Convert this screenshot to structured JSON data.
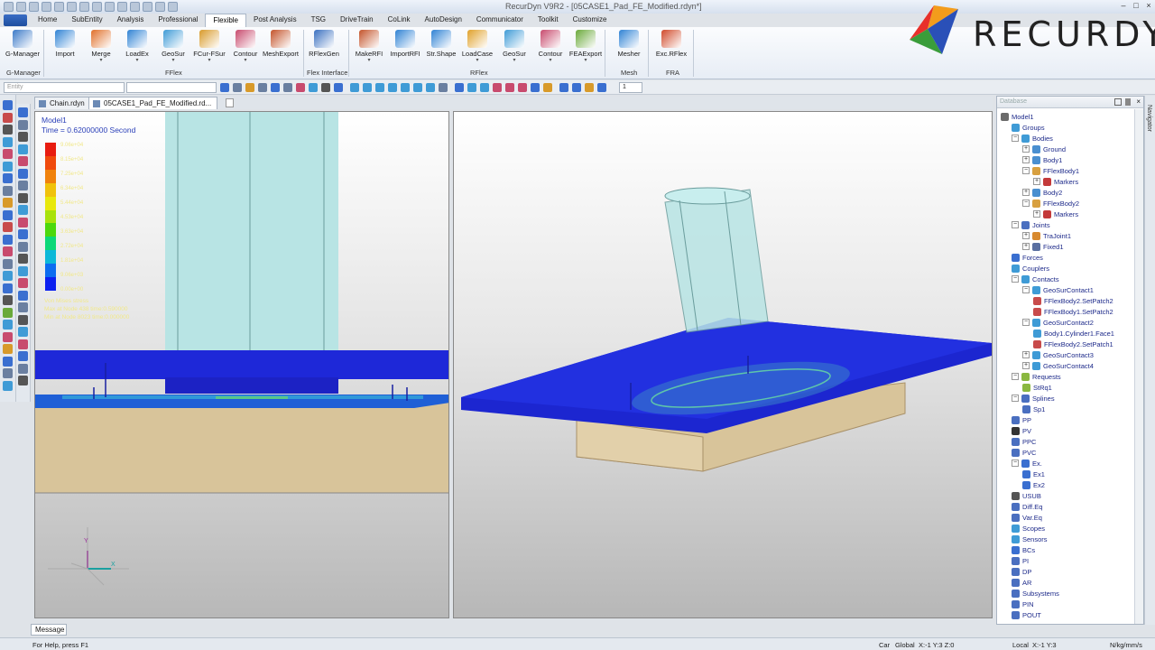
{
  "window": {
    "title": "RecurDyn V9R2 - [05CASE1_Pad_FE_Modified.rdyn*]",
    "controls": [
      "–",
      "□",
      "×"
    ]
  },
  "menu": {
    "tabs": [
      "Home",
      "SubEntity",
      "Analysis",
      "Professional",
      "Flexible",
      "Post Analysis",
      "TSG",
      "DriveTrain",
      "CoLink",
      "AutoDesign",
      "Communicator",
      "Toolkit",
      "Customize"
    ],
    "active": "Flexible"
  },
  "ribbon": {
    "buttons": [
      {
        "label": "G-Manager",
        "arrow": "",
        "color": "#3c7ac8"
      },
      {
        "label": "Import",
        "arrow": "",
        "color": "#2f82d4"
      },
      {
        "label": "Merge",
        "arrow": "▾",
        "color": "#e0702a"
      },
      {
        "label": "LoadEx",
        "arrow": "▾",
        "color": "#2f82d4"
      },
      {
        "label": "GeoSur",
        "arrow": "▾",
        "color": "#3f9bd6"
      },
      {
        "label": "FCur-FSur",
        "arrow": "▾",
        "color": "#d89a2a"
      },
      {
        "label": "Contour",
        "arrow": "▾",
        "color": "#c84b6e"
      },
      {
        "label": "MeshExport",
        "arrow": "",
        "color": "#c4542b"
      },
      {
        "label": "RFlexGen",
        "arrow": "",
        "color": "#3a70c0"
      },
      {
        "label": "MakeRFI",
        "arrow": "▾",
        "color": "#c4542b"
      },
      {
        "label": "ImportRFI",
        "arrow": "",
        "color": "#2f82d4"
      },
      {
        "label": "Str.Shape",
        "arrow": "",
        "color": "#2f82d4"
      },
      {
        "label": "LoadCase",
        "arrow": "▾",
        "color": "#e0a12a"
      },
      {
        "label": "GeoSur",
        "arrow": "▾",
        "color": "#3f9bd6"
      },
      {
        "label": "Contour",
        "arrow": "▾",
        "color": "#c84b6e"
      },
      {
        "label": "FEAExport",
        "arrow": "▾",
        "color": "#6aa93a"
      },
      {
        "label": "Mesher",
        "arrow": "",
        "color": "#2f82d4"
      },
      {
        "label": "Exc.RFlex",
        "arrow": "",
        "color": "#d04a2a"
      }
    ],
    "groups": [
      "G-Manager",
      "FFlex",
      "Flex Interface",
      "RFlex",
      "Mesh",
      "FRA"
    ]
  },
  "brand": {
    "logo_text": "RECURDYN"
  },
  "toolbar": {
    "entity_placeholder": "Entity",
    "step_value": "1"
  },
  "doc_tabs": [
    {
      "label": "Chain.rdyn"
    },
    {
      "label": "05CASE1_Pad_FE_Modified.rd..."
    }
  ],
  "viewport_left": {
    "model_name": "Model1",
    "time_text": "Time = 0.62000000  Second",
    "legend_values": [
      "9.06e+04",
      "8.15e+04",
      "7.25e+04",
      "6.34e+04",
      "5.44e+04",
      "4.53e+04",
      "3.63e+04",
      "2.72e+04",
      "1.81e+04",
      "9.06e+03",
      "0.00e+00"
    ],
    "legend_colors": [
      "#e81c10",
      "#f04a0c",
      "#f0820c",
      "#f0c20c",
      "#e8e80c",
      "#a8e20c",
      "#4cd80c",
      "#0cd878",
      "#0cb8d8",
      "#0c6cf0",
      "#0c20f0"
    ],
    "stress_title": "Von Mises stress",
    "stress_max": "Max at Node 438 time:0.590000",
    "stress_min": "Min at Node 8023 time:0.000000",
    "axis_x": "X",
    "axis_y": "Y",
    "axis_z": "Z"
  },
  "database": {
    "title": "Database",
    "tree": [
      {
        "label": "Model1",
        "level": 0,
        "toggle": "",
        "icon": "#6b6b6b"
      },
      {
        "label": "Groups",
        "level": 1,
        "toggle": "",
        "icon": "#3f9bd6"
      },
      {
        "label": "Bodies",
        "level": 1,
        "toggle": "−",
        "icon": "#3f9bd6"
      },
      {
        "label": "Ground",
        "level": 2,
        "toggle": "+",
        "icon": "#4a8fd0"
      },
      {
        "label": "Body1",
        "level": 2,
        "toggle": "+",
        "icon": "#4a8fd0"
      },
      {
        "label": "FFlexBody1",
        "level": 2,
        "toggle": "−",
        "icon": "#d8a040"
      },
      {
        "label": "Markers",
        "level": 3,
        "toggle": "+",
        "icon": "#c43a3a"
      },
      {
        "label": "Body2",
        "level": 2,
        "toggle": "+",
        "icon": "#4a8fd0"
      },
      {
        "label": "FFlexBody2",
        "level": 2,
        "toggle": "−",
        "icon": "#d8a040"
      },
      {
        "label": "Markers",
        "level": 3,
        "toggle": "+",
        "icon": "#c43a3a"
      },
      {
        "label": "Joints",
        "level": 1,
        "toggle": "−",
        "icon": "#4a6fc0"
      },
      {
        "label": "TraJoint1",
        "level": 2,
        "toggle": "+",
        "icon": "#d88a30"
      },
      {
        "label": "Fixed1",
        "level": 2,
        "toggle": "+",
        "icon": "#5a6fa0"
      },
      {
        "label": "Forces",
        "level": 1,
        "toggle": "",
        "icon": "#3a6fd0"
      },
      {
        "label": "Couplers",
        "level": 1,
        "toggle": "",
        "icon": "#3f9bd6"
      },
      {
        "label": "Contacts",
        "level": 1,
        "toggle": "−",
        "icon": "#3f9bd6"
      },
      {
        "label": "GeoSurContact1",
        "level": 2,
        "toggle": "−",
        "icon": "#3f9bd6"
      },
      {
        "label": "FFlexBody2.SetPatch2",
        "level": 3,
        "toggle": "",
        "icon": "#c84b4b"
      },
      {
        "label": "FFlexBody1.SetPatch2",
        "level": 3,
        "toggle": "",
        "icon": "#c84b4b"
      },
      {
        "label": "GeoSurContact2",
        "level": 2,
        "toggle": "−",
        "icon": "#3f9bd6"
      },
      {
        "label": "Body1.Cylinder1.Face1",
        "level": 3,
        "toggle": "",
        "icon": "#3f9bd6"
      },
      {
        "label": "FFlexBody2.SetPatch1",
        "level": 3,
        "toggle": "",
        "icon": "#c84b4b"
      },
      {
        "label": "GeoSurContact3",
        "level": 2,
        "toggle": "+",
        "icon": "#3f9bd6"
      },
      {
        "label": "GeoSurContact4",
        "level": 2,
        "toggle": "+",
        "icon": "#3f9bd6"
      },
      {
        "label": "Requests",
        "level": 1,
        "toggle": "−",
        "icon": "#8ab840"
      },
      {
        "label": "StRq1",
        "level": 2,
        "toggle": "",
        "icon": "#8ab840"
      },
      {
        "label": "Splines",
        "level": 1,
        "toggle": "−",
        "icon": "#4a6fc0"
      },
      {
        "label": "Sp1",
        "level": 2,
        "toggle": "",
        "icon": "#4a6fc0"
      },
      {
        "label": "PP",
        "level": 1,
        "toggle": "",
        "icon": "#4a6fc0"
      },
      {
        "label": "PV",
        "level": 1,
        "toggle": "",
        "icon": "#333333"
      },
      {
        "label": "PPC",
        "level": 1,
        "toggle": "",
        "icon": "#4a6fc0"
      },
      {
        "label": "PVC",
        "level": 1,
        "toggle": "",
        "icon": "#4a6fc0"
      },
      {
        "label": "Ex.",
        "level": 1,
        "toggle": "−",
        "icon": "#3a6fd0"
      },
      {
        "label": "Ex1",
        "level": 2,
        "toggle": "",
        "icon": "#3a6fd0"
      },
      {
        "label": "Ex2",
        "level": 2,
        "toggle": "",
        "icon": "#3a6fd0"
      },
      {
        "label": "USUB",
        "level": 1,
        "toggle": "",
        "icon": "#555555"
      },
      {
        "label": "Diff.Eq",
        "level": 1,
        "toggle": "",
        "icon": "#4a6fc0"
      },
      {
        "label": "Var.Eq",
        "level": 1,
        "toggle": "",
        "icon": "#4a6fc0"
      },
      {
        "label": "Scopes",
        "level": 1,
        "toggle": "",
        "icon": "#3f9bd6"
      },
      {
        "label": "Sensors",
        "level": 1,
        "toggle": "",
        "icon": "#3f9bd6"
      },
      {
        "label": "BCs",
        "level": 1,
        "toggle": "",
        "icon": "#3a6fd0"
      },
      {
        "label": "PI",
        "level": 1,
        "toggle": "",
        "icon": "#4a6fc0"
      },
      {
        "label": "DP",
        "level": 1,
        "toggle": "",
        "icon": "#4a6fc0"
      },
      {
        "label": "AR",
        "level": 1,
        "toggle": "",
        "icon": "#4a6fc0"
      },
      {
        "label": "Subsystems",
        "level": 1,
        "toggle": "",
        "icon": "#4a6fc0"
      },
      {
        "label": "PIN",
        "level": 1,
        "toggle": "",
        "icon": "#4a6fc0"
      },
      {
        "label": "POUT",
        "level": 1,
        "toggle": "",
        "icon": "#4a6fc0"
      }
    ]
  },
  "navigator": {
    "label": "Navigator"
  },
  "bottom": {
    "message_tab": "Message",
    "status_help": "For Help, press F1",
    "status_car": "Car",
    "status_global": "Global",
    "status_global_coords": "X:-1 Y:3 Z:0",
    "status_local": "Local",
    "status_local_coords": "X:-1 Y:3",
    "status_units": "N/kg/mm/s"
  }
}
